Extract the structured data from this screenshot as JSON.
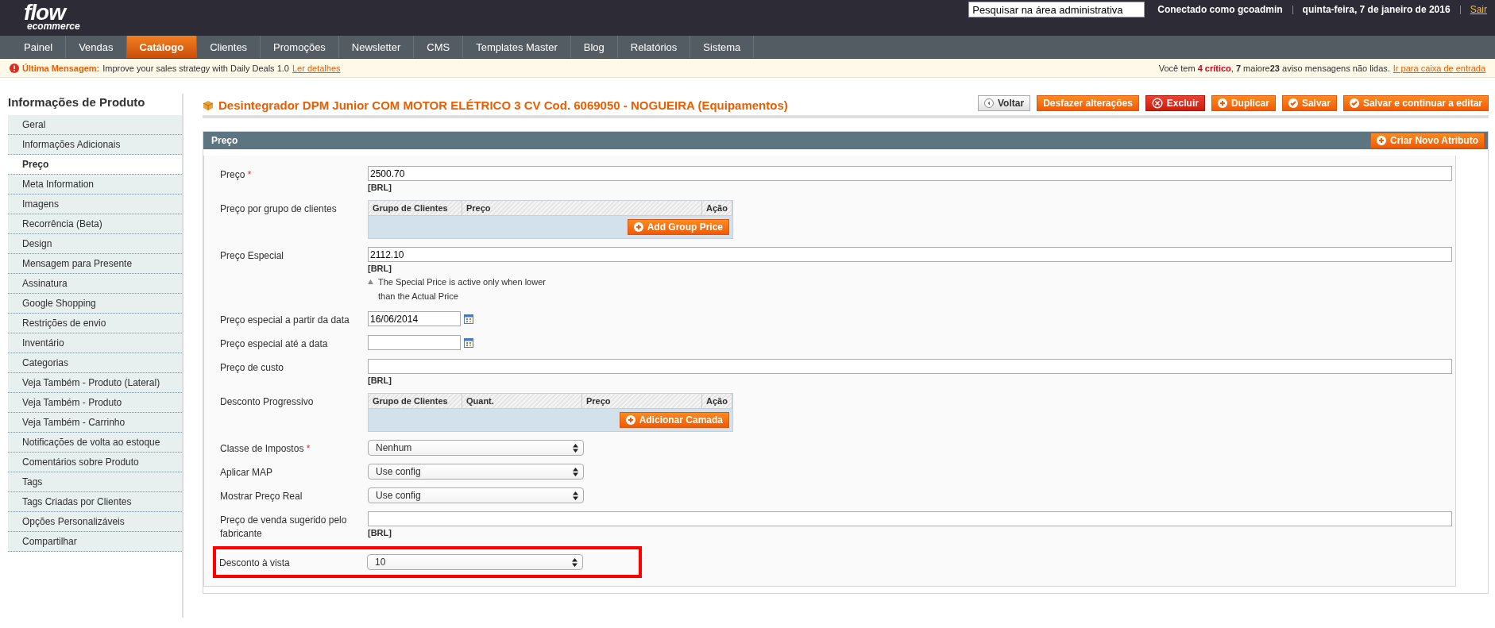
{
  "header": {
    "logo": {
      "line1": "flow",
      "line2": "ecommerce"
    },
    "search": {
      "value": "Pesquisar na área administrativa"
    },
    "user": "Conectado como gcoadmin",
    "date": "quinta-feira, 7 de janeiro de 2016",
    "logout": "Sair"
  },
  "nav": [
    {
      "label": "Painel",
      "selected": false
    },
    {
      "label": "Vendas",
      "selected": false
    },
    {
      "label": "Catálogo",
      "selected": true
    },
    {
      "label": "Clientes",
      "selected": false
    },
    {
      "label": "Promoções",
      "selected": false
    },
    {
      "label": "Newsletter",
      "selected": false
    },
    {
      "label": "CMS",
      "selected": false
    },
    {
      "label": "Templates Master",
      "selected": false
    },
    {
      "label": "Blog",
      "selected": false
    },
    {
      "label": "Relatórios",
      "selected": false
    },
    {
      "label": "Sistema",
      "selected": false
    }
  ],
  "message": {
    "label": "Última Mensagem:",
    "text": "Improve your sales strategy with Daily Deals 1.0",
    "link": "Ler detalhes",
    "summary": [
      {
        "text": "Você tem ",
        "kind": "plain"
      },
      {
        "text": "4 crítico",
        "kind": "critical"
      },
      {
        "text": ", ",
        "kind": "plain"
      },
      {
        "text": "7",
        "kind": "bold"
      },
      {
        "text": " maiore",
        "kind": "plain"
      },
      {
        "text": "23",
        "kind": "bold"
      },
      {
        "text": " aviso mensagens não lidas.",
        "kind": "plain"
      }
    ],
    "summary_link": "Ir para caixa de entrada"
  },
  "sidebar": {
    "title": "Informações de Produto",
    "items": [
      {
        "label": "Geral",
        "selected": false
      },
      {
        "label": "Informações Adicionais",
        "selected": false
      },
      {
        "label": "Preço",
        "selected": true
      },
      {
        "label": "Meta Information",
        "selected": false
      },
      {
        "label": "Imagens",
        "selected": false
      },
      {
        "label": "Recorrência (Beta)",
        "selected": false
      },
      {
        "label": "Design",
        "selected": false
      },
      {
        "label": "Mensagem para Presente",
        "selected": false
      },
      {
        "label": "Assinatura",
        "selected": false
      },
      {
        "label": "Google Shopping",
        "selected": false
      },
      {
        "label": "Restrições de envio",
        "selected": false
      },
      {
        "label": "Inventário",
        "selected": false
      },
      {
        "label": "Categorias",
        "selected": false
      },
      {
        "label": "Veja Também - Produto (Lateral)",
        "selected": false
      },
      {
        "label": "Veja Também - Produto",
        "selected": false
      },
      {
        "label": "Veja Também - Carrinho",
        "selected": false
      },
      {
        "label": "Notificações de volta ao estoque",
        "selected": false
      },
      {
        "label": "Comentários sobre Produto",
        "selected": false
      },
      {
        "label": "Tags",
        "selected": false
      },
      {
        "label": "Tags Criadas por Clientes",
        "selected": false
      },
      {
        "label": "Opções Personalizáveis",
        "selected": false
      },
      {
        "label": "Compartilhar",
        "selected": false
      }
    ]
  },
  "page_title": "Desintegrador DPM Junior COM MOTOR ELÉTRICO 3 CV Cod. 6069050 - NOGUEIRA (Equipamentos)",
  "actions": [
    {
      "label": "Voltar",
      "kind": "back"
    },
    {
      "label": "Desfazer alterações",
      "kind": "plain"
    },
    {
      "label": "Excluir",
      "kind": "delete"
    },
    {
      "label": "Duplicar",
      "kind": "add"
    },
    {
      "label": "Salvar",
      "kind": "save"
    },
    {
      "label": "Salvar e continuar a editar",
      "kind": "save"
    }
  ],
  "section": {
    "title": "Preço",
    "button": "Criar Novo Atributo",
    "fields": [
      {
        "kind": "text",
        "label": "Preço",
        "required_mark": "*",
        "value": "2500.70",
        "currency": "[BRL]",
        "highlighted": false
      },
      {
        "kind": "grid",
        "label": "Preço por grupo de clientes",
        "columns": [
          "Grupo de Clientes",
          "Preço",
          "Ação"
        ],
        "button": "Add Group Price",
        "highlighted": false
      },
      {
        "kind": "text",
        "label": "Preço Especial",
        "value": "2112.10",
        "currency": "[BRL]",
        "note": "The Special Price is active only when lower than the Actual Price",
        "highlighted": false
      },
      {
        "kind": "date",
        "label": "Preço especial a partir da data",
        "value": "16/06/2014",
        "highlighted": false
      },
      {
        "kind": "date",
        "label": "Preço especial até a data",
        "highlighted": false
      },
      {
        "kind": "text",
        "label": "Preço de custo",
        "currency": "[BRL]",
        "highlighted": false
      },
      {
        "kind": "grid",
        "label": "Desconto Progressivo",
        "columns": [
          "Grupo de Clientes",
          "Quant.",
          "Preço",
          "Ação"
        ],
        "button": "Adicionar Camada",
        "highlighted": false
      },
      {
        "kind": "select",
        "label": "Classe de Impostos",
        "required_mark": "*",
        "value": "Nenhum",
        "highlighted": false
      },
      {
        "kind": "select",
        "label": "Aplicar MAP",
        "value": "Use config",
        "highlighted": false
      },
      {
        "kind": "select",
        "label": "Mostrar Preço Real",
        "value": "Use config",
        "highlighted": false
      },
      {
        "kind": "text",
        "label": "Preço de venda sugerido pelo fabricante",
        "currency": "[BRL]",
        "highlighted": false
      },
      {
        "kind": "select",
        "label": "Desconto à vista",
        "value": "10",
        "highlighted": true
      }
    ]
  }
}
